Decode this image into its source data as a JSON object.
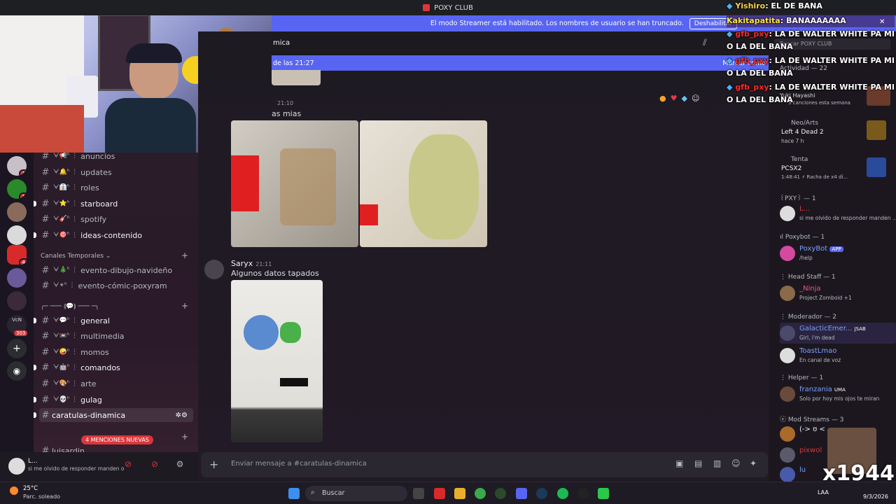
{
  "window": {
    "title": "POXY CLUB"
  },
  "banner": {
    "text": "El modo Streamer está habilitado. Los nombres de usuario se han truncado.",
    "button": "Deshabilitar"
  },
  "chat_header": {
    "channel_fragment": "mica"
  },
  "new_messages": {
    "since": "de las 21:27",
    "action": "Marcar como"
  },
  "servers": [
    {
      "badge": "1"
    },
    {
      "badge": "1"
    },
    {
      "badge": ""
    },
    {
      "badge": ""
    },
    {
      "badge": "4"
    },
    {
      "badge": ""
    },
    {
      "badge": ""
    },
    {
      "badge": "303",
      "label": "VcN"
    }
  ],
  "channels_top": [
    {
      "label": "anuncios",
      "deco": "ᗄ📢ʱ ⋮",
      "bold": false
    },
    {
      "label": "updates",
      "deco": "ᗄ🔔ʱ ⋮",
      "bold": false
    },
    {
      "label": "roles",
      "deco": "ᗄ👔ʱ ⋮",
      "bold": false
    },
    {
      "label": "starboard",
      "deco": "ᗄ⭐ʱ ⋮",
      "bold": true
    },
    {
      "label": "spotify",
      "deco": "ᗄ🎸ʱ ⋮",
      "bold": false
    },
    {
      "label": "ideas-contenido",
      "deco": "ᗄ🎯ʱ ⋮",
      "bold": true
    }
  ],
  "category_temp": "Canales Temporales",
  "channels_temp": [
    {
      "label": "evento-dibujo-navideño",
      "deco": "ᗄ🎄ʱ ⋮"
    },
    {
      "label": "evento-cómic-poxyram",
      "deco": "ᗄ✴ʱ ⋮"
    }
  ],
  "category_deco": "╭─ ─── ⟬💬⟭ ─── ─╮",
  "channels_main": [
    {
      "label": "general",
      "deco": "ᗄ💬ʱ ⋮",
      "bold": true
    },
    {
      "label": "multimedia",
      "deco": "ᗄ📼ʱ ⋮",
      "bold": false
    },
    {
      "label": "momos",
      "deco": "ᗄ🤪ʱ ⋮",
      "bold": false
    },
    {
      "label": "comandos",
      "deco": "ᗄ🤖ʱ ⋮",
      "bold": true
    },
    {
      "label": "arte",
      "deco": "ᗄ🎨ʱ ⋮",
      "bold": false
    },
    {
      "label": "gulag",
      "deco": "ᗄ💀ʱ ⋮",
      "bold": true
    },
    {
      "label": "caratulas-dinamica",
      "deco": "",
      "bold": true
    }
  ],
  "mentions_pill": "4 MENCIONES NUEVAS",
  "channel_partial": "luisardin",
  "messages": [
    {
      "time": "21:10",
      "text": "as mias"
    },
    {
      "author": "Saryx",
      "time": "21:11",
      "text": "Algunos datos tapados"
    }
  ],
  "composer": {
    "placeholder": "Enviar mensaje a #caratulas-dinamica"
  },
  "search": {
    "placeholder": "Buscar POXY CLUB"
  },
  "activity": {
    "header": "Actividad — 22",
    "name": "Yuki Hayashi",
    "sub": "3 canciones esta semana"
  },
  "activities": [
    {
      "name": "Neo/Arts",
      "game": "Left 4 Dead 2",
      "time": "hace 7 h"
    },
    {
      "name": "Tenta",
      "game": "PCSX2",
      "time": "1:48:41",
      "extra": "Racha de x4 dí..."
    }
  ],
  "member_groups": [
    {
      "title": "꒰PXY꒱ — 1",
      "members": [
        {
          "name": "L...",
          "status": "si me olvido de responder manden ..."
        }
      ]
    },
    {
      "title": "ıl Poxybot — 1",
      "members": [
        {
          "name": "PoxyBot",
          "tag": "APP",
          "status": "/help"
        }
      ]
    },
    {
      "title": "⋮ Head Staff — 1",
      "members": [
        {
          "name": "_Ninja",
          "status": "Project Zomboid +1"
        }
      ]
    },
    {
      "title": "⋮ Moderador — 2",
      "members": [
        {
          "name": "GalacticEmer...",
          "tag": "JSAB",
          "status": "Girl, i'm dead"
        },
        {
          "name": "ToastLmao",
          "status": "En canal de voz"
        }
      ]
    },
    {
      "title": "⋮ Helper — 1",
      "members": [
        {
          "name": "franzania",
          "tag": "UMA",
          "status": "Solo por hoy mis ojos te miran"
        }
      ]
    },
    {
      "title": "ⓔ Mod Streams — 3",
      "members": [
        {
          "name": "(-> ʊ <",
          "status": ""
        },
        {
          "name": "pixwol",
          "status": ""
        },
        {
          "name": "lu",
          "status": ""
        }
      ]
    }
  ],
  "twitch_chat": [
    {
      "user": "Yishiro",
      "text": ": EL DE BANA",
      "color": "#ffd34d"
    },
    {
      "user": "Kakitapatita",
      "text": ": BANAAAAAAA",
      "color": "#ffe34d"
    },
    {
      "user": "gfb_pxy",
      "text": ": LA DE WALTER WHITE PA MI O LA DEL BANA",
      "color": "#ff2a2a"
    },
    {
      "user": "gfb_pxy",
      "text": ": LA DE WALTER WHITE PA MI O LA DEL BANA",
      "color": "#ff2a2a"
    },
    {
      "user": "gfb_pxy",
      "text": ": LA DE WALTER WHITE PA MI O LA DEL BANA",
      "color": "#ff2a2a"
    }
  ],
  "user_panel": {
    "name": "L...",
    "status": "si me olvido de responder manden o"
  },
  "taskbar": {
    "temp": "25°C",
    "weather": "Parc. soleado",
    "search": "Buscar",
    "lang": "LAA",
    "date": "9/3/2026",
    "overlay": "x1944"
  }
}
